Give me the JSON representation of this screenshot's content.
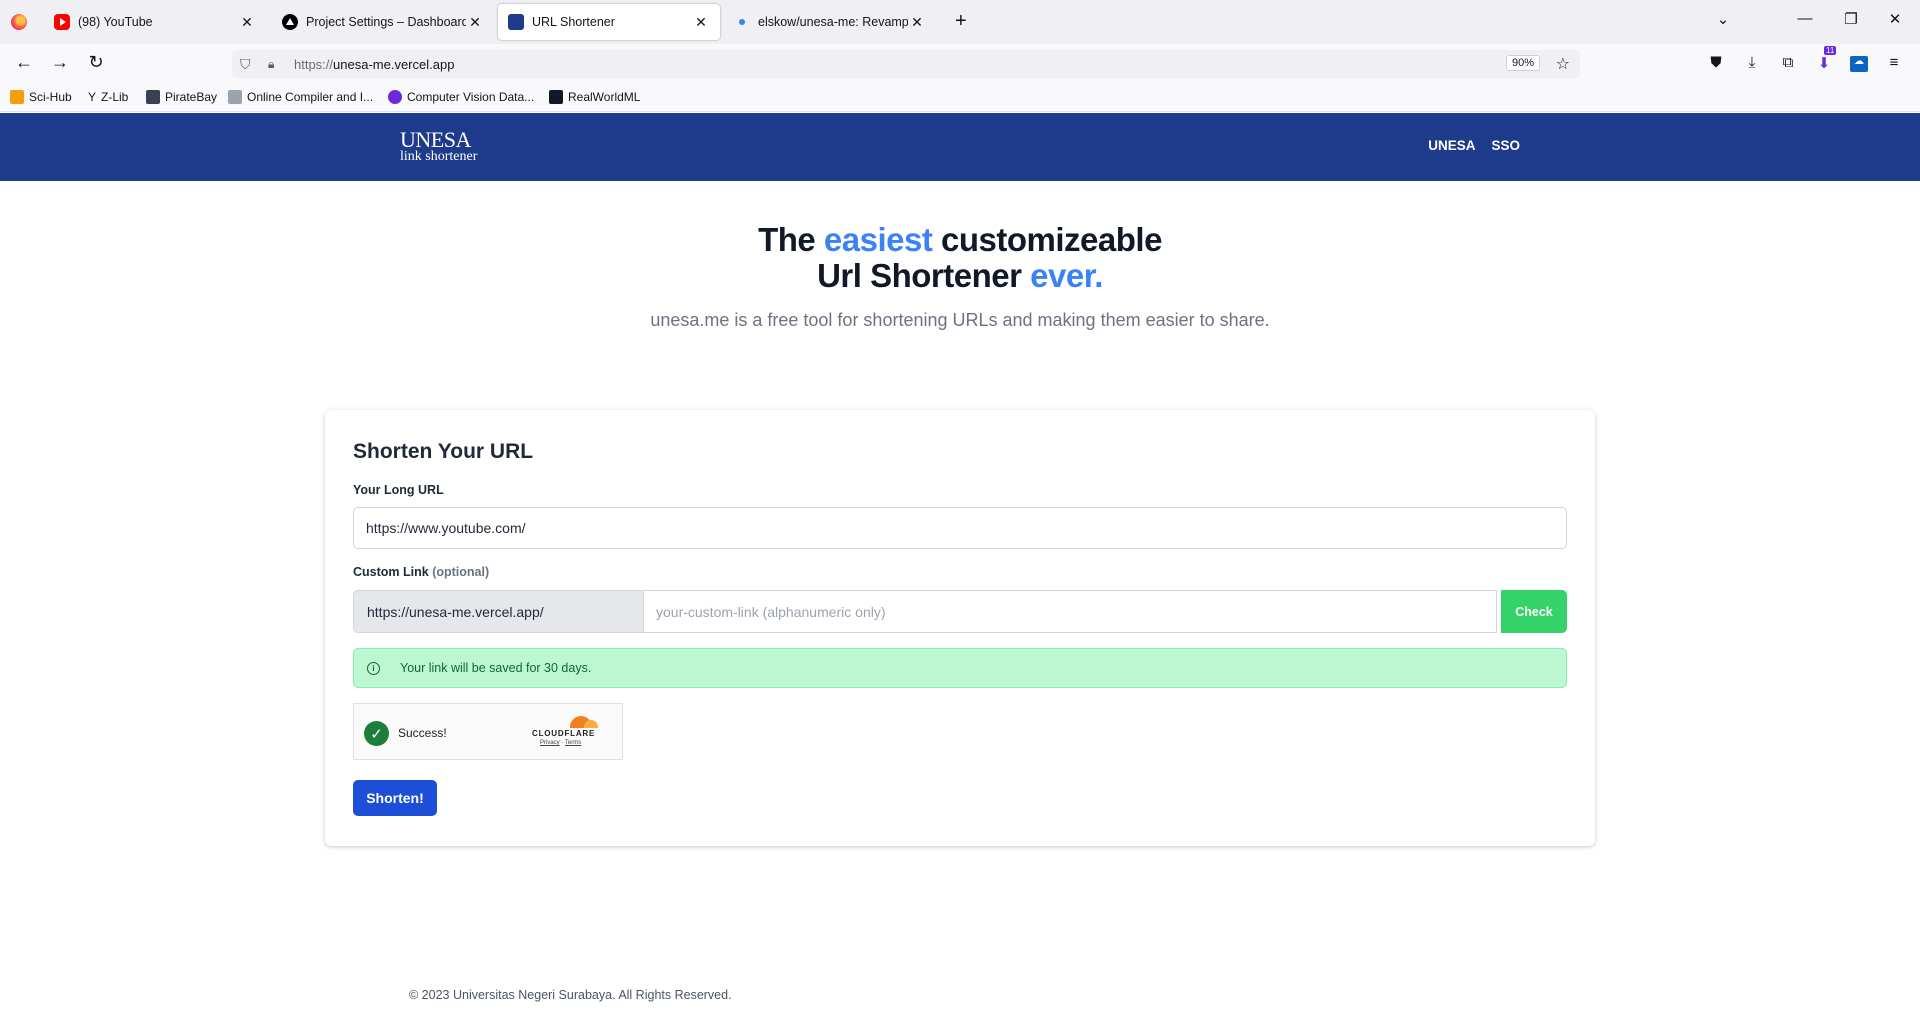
{
  "browser": {
    "tabs": [
      {
        "title": "(98) YouTube",
        "active": false
      },
      {
        "title": "Project Settings – Dashboard – Ve",
        "active": false
      },
      {
        "title": "URL Shortener",
        "active": true
      },
      {
        "title": "elskow/unesa-me: Revamped u",
        "active": false
      }
    ],
    "address": {
      "proto": "https://",
      "host": "unesa-me.vercel.app"
    },
    "zoom": "90%",
    "extension_badge": "11",
    "bookmarks": [
      "Sci-Hub",
      "Z-Lib",
      "PirateBay",
      "Online Compiler and I...",
      "Computer Vision Data...",
      "RealWorldML"
    ]
  },
  "site": {
    "logo_line1": "UNESA",
    "logo_line2": "link shortener",
    "nav": [
      "UNESA",
      "SSO"
    ],
    "brand_color": "#1e3a8a",
    "accent_color": "#3b82f6"
  },
  "hero": {
    "line1_a": "The ",
    "line1_highlight": "easiest",
    "line1_b": " customizeable",
    "line2_a": "Url Shortener ",
    "line2_highlight": "ever.",
    "subtitle": "unesa.me is a free tool for shortening URLs and making them easier to share."
  },
  "form": {
    "title": "Shorten Your URL",
    "long_url_label": "Your Long URL",
    "long_url_value": "https://www.youtube.com/",
    "custom_label": "Custom Link",
    "custom_label_optional": "(optional)",
    "custom_prefix": "https://unesa-me.vercel.app/",
    "custom_placeholder": "your-custom-link (alphanumeric only)",
    "check_label": "Check",
    "alert_text": "Your link will be saved for 30 days.",
    "captcha_status": "Success!",
    "captcha_brand": "CLOUDFLARE",
    "captcha_privacy": "Privacy",
    "captcha_terms": "Terms",
    "submit_label": "Shorten!"
  },
  "footer": {
    "text": "© 2023 Universitas Negeri Surabaya. All Rights Reserved."
  }
}
